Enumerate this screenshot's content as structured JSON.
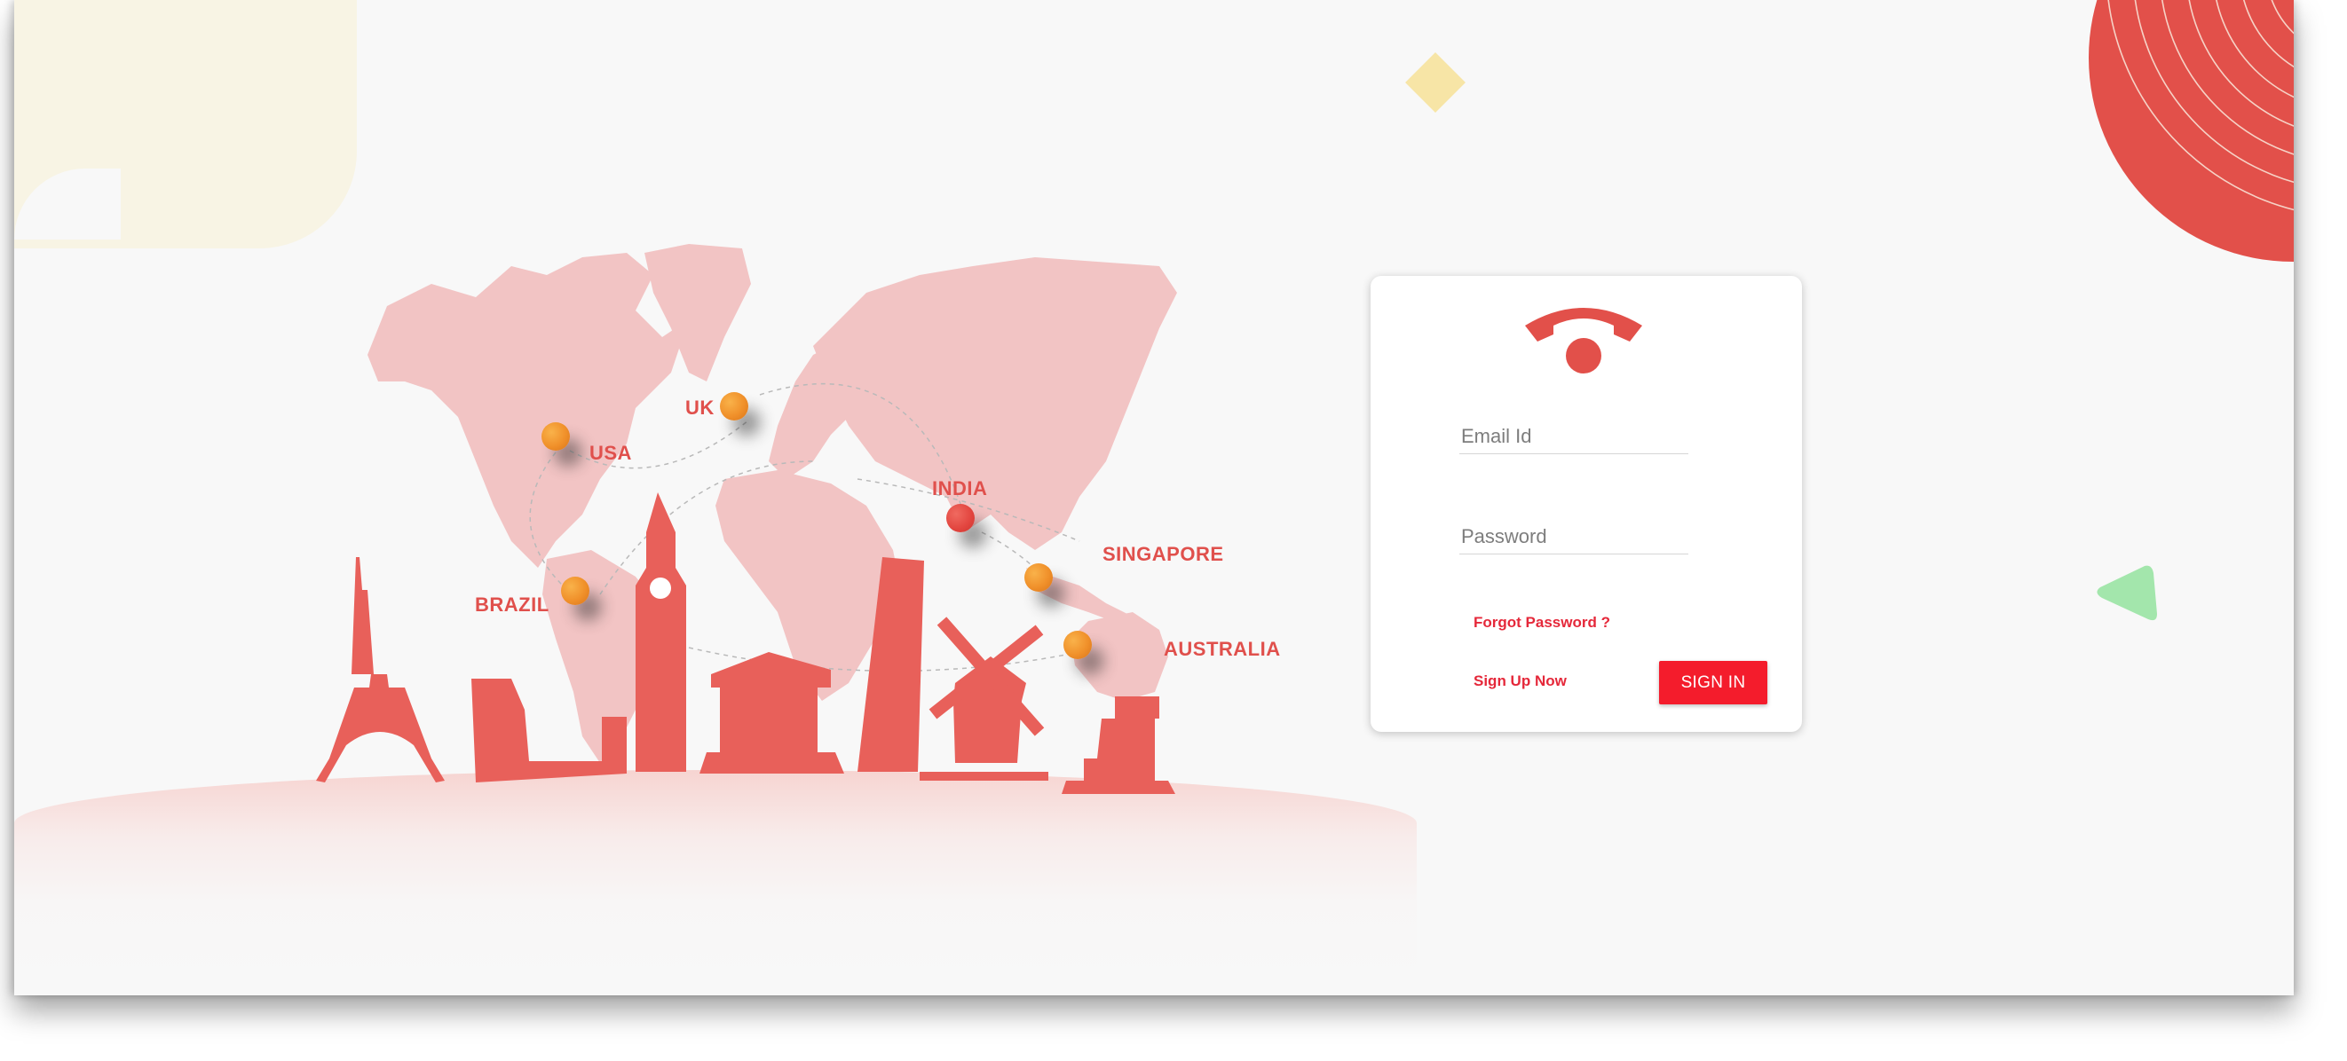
{
  "illustration": {
    "locations": [
      {
        "label": "USA",
        "pin_color": "orange"
      },
      {
        "label": "UK",
        "pin_color": "orange"
      },
      {
        "label": "INDIA",
        "pin_color": "red"
      },
      {
        "label": "SINGAPORE",
        "pin_color": "orange"
      },
      {
        "label": "BRAZIL",
        "pin_color": "orange"
      },
      {
        "label": "AUSTRALIA",
        "pin_color": "orange"
      }
    ],
    "monuments": [
      "eiffel-tower",
      "colosseum",
      "big-ben",
      "parthenon",
      "leaning-tower-of-pisa",
      "windmill",
      "greek-temple-ruins"
    ]
  },
  "login": {
    "logo_icon": "phone-handset-icon",
    "email": {
      "placeholder": "Email Id",
      "value": ""
    },
    "password": {
      "placeholder": "Password",
      "value": ""
    },
    "forgot_password_label": "Forgot Password ?",
    "sign_up_label": "Sign Up Now",
    "sign_in_label": "SIGN IN"
  },
  "colors": {
    "brand_red": "#e2504a",
    "button_red": "#f41c2c",
    "link_red": "#e5283a",
    "map_pink": "#f2c4c4",
    "monument_red": "#e8605a",
    "accent_yellow": "#f7e5a6",
    "accent_green": "#a3e6ac",
    "background": "#f8f8f8"
  }
}
